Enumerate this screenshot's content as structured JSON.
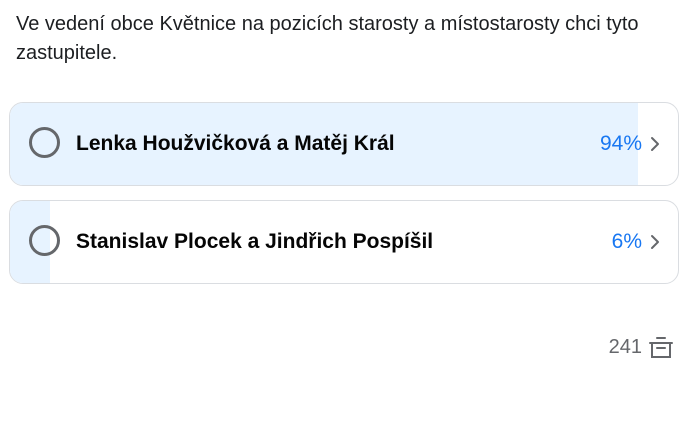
{
  "question": "Ve vedení obce Květnice na pozicích starosty a místostarosty chci tyto zastupitele.",
  "options": [
    {
      "label": "Lenka Houžvičková a Matěj Král",
      "percent": "94%",
      "fill_fraction": 0.94
    },
    {
      "label": "Stanislav Plocek a Jindřich Pospíšil",
      "percent": "6%",
      "fill_fraction": 0.06
    }
  ],
  "footer": {
    "vote_count": "241",
    "icon": "ballot-box-icon"
  },
  "colors": {
    "fill": "#e7f3ff",
    "percent": "#1877f2",
    "radio_border": "#65676b"
  }
}
